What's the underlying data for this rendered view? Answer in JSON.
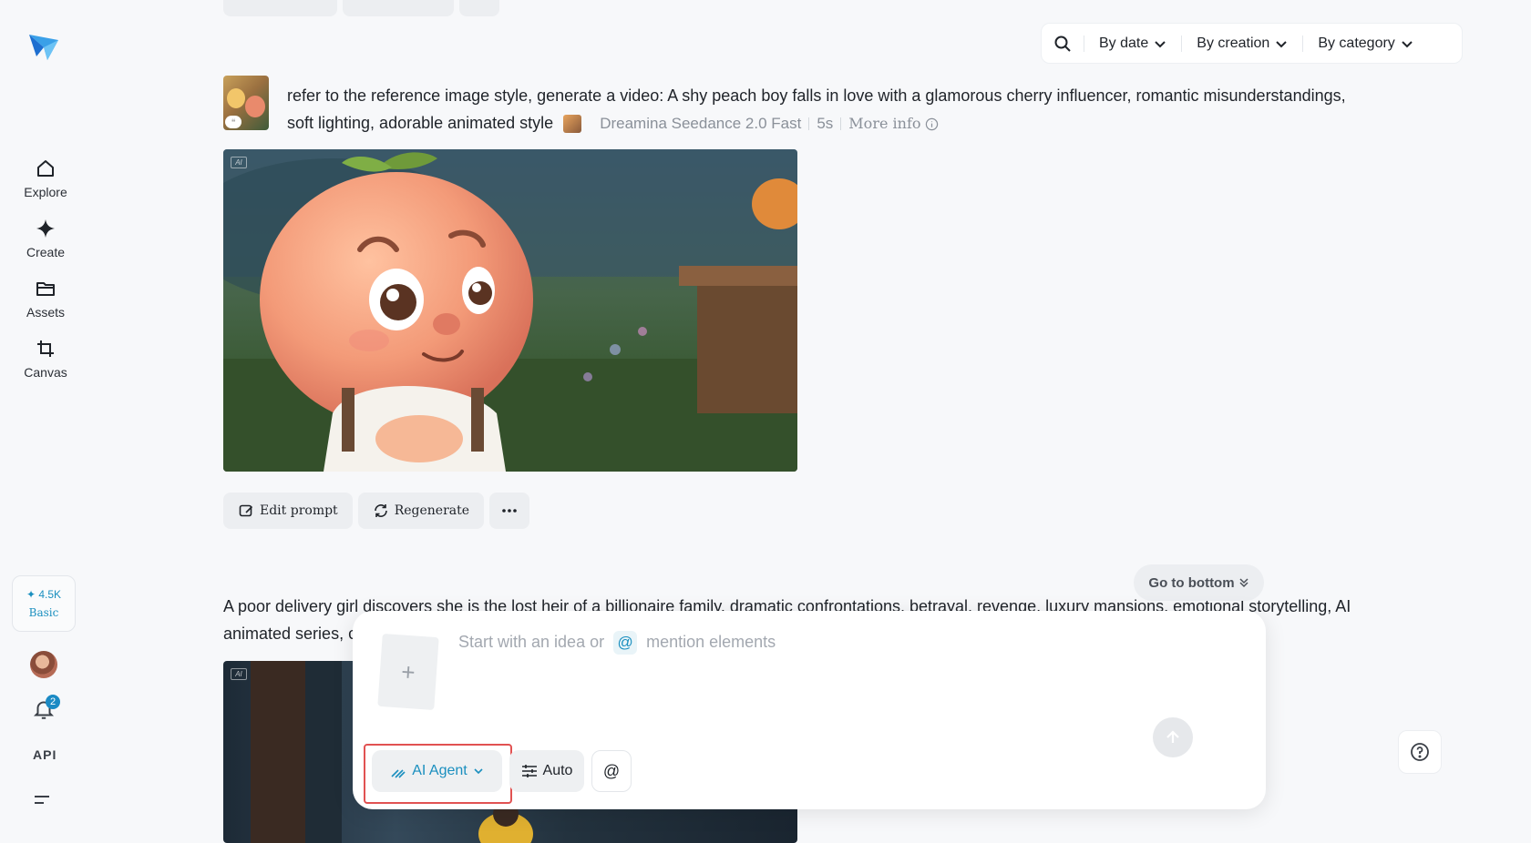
{
  "sidebar": {
    "items": [
      {
        "label": "Explore",
        "icon": "home-icon"
      },
      {
        "label": "Create",
        "icon": "diamond-icon"
      },
      {
        "label": "Assets",
        "icon": "folder-icon"
      },
      {
        "label": "Canvas",
        "icon": "crop-icon"
      }
    ],
    "credits": {
      "amount": "✦ 4.5K",
      "plan": "Basic"
    },
    "notifications_count": "2",
    "api_label": "API"
  },
  "filters": {
    "by_date": "By date",
    "by_creation": "By creation",
    "by_category": "By category"
  },
  "generation1": {
    "prompt": "refer to the reference image style, generate a video: A shy peach boy falls in love with a glamorous cherry influencer, romantic misunderstandings, soft lighting, adorable animated style",
    "model": "Dreamina Seedance 2.0 Fast",
    "duration": "5s",
    "more_info": "More info",
    "ai_badge": "AI",
    "actions": {
      "edit_prompt": "Edit prompt",
      "regenerate": "Regenerate"
    }
  },
  "generation2": {
    "prompt": "A poor delivery girl discovers she is the lost heir of a billionaire family, dramatic confrontations, betrayal, revenge, luxury mansions, emotional storytelling, AI animated series, c",
    "ai_badge": "AI"
  },
  "go_to_bottom": "Go to bottom",
  "composer": {
    "placeholder_start": "Start with an idea or",
    "placeholder_end": "mention elements",
    "at_symbol": "@",
    "agent_label": "AI Agent",
    "auto_label": "Auto",
    "at_button": "@",
    "upload_symbol": "+"
  },
  "colors": {
    "accent": "#1a8fbf",
    "highlight_border": "#e15252"
  }
}
